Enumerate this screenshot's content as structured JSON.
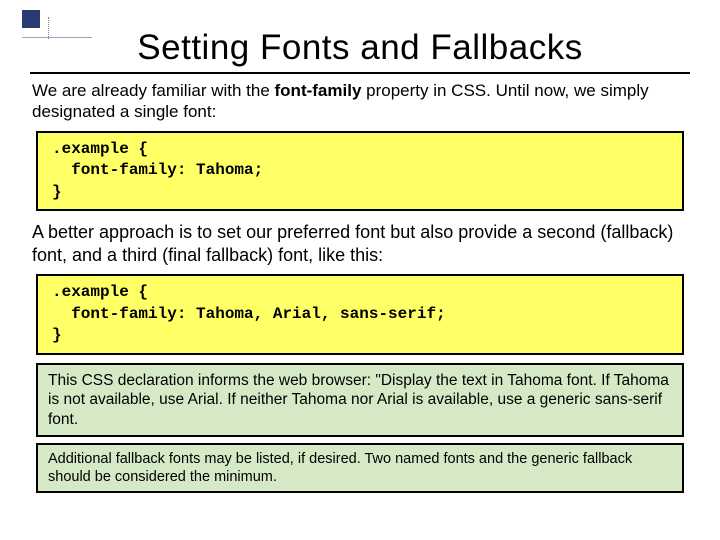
{
  "title": "Setting Fonts and Fallbacks",
  "intro_html": "We are already familiar with the <b class=\"kw\">font-family</b> property in CSS.  Until now, we simply designated a single font:",
  "code1": ".example {\n  font-family: Tahoma;\n}",
  "para2": "A better approach is to set our preferred font but also provide a second (fallback) font, and a third (final fallback) font, like this:",
  "code2": ".example {\n  font-family: Tahoma, Arial, sans-serif;\n}",
  "note1": "This CSS declaration informs the web browser: \"Display the text in Tahoma font.  If Tahoma is not available, use Arial.  If neither Tahoma nor Arial is available, use a generic sans-serif font.",
  "note2": "Additional fallback fonts may be listed, if desired.  Two named fonts and the generic fallback should be considered the minimum."
}
